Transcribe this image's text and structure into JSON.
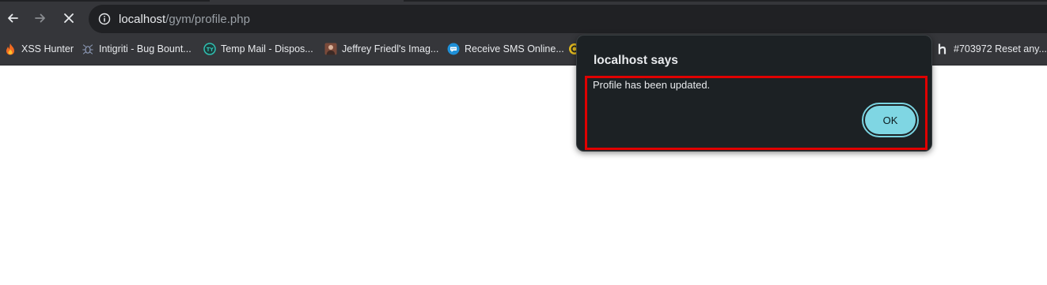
{
  "browser": {
    "url_host": "localhost",
    "url_path": "/gym/profile.php",
    "nav": {
      "back_icon": "arrow-left-icon",
      "forward_icon": "arrow-right-icon",
      "stop_icon": "close-icon",
      "site_info_icon": "info-icon"
    },
    "colors": {
      "toolbar": "#35363a",
      "omnibox": "#202124",
      "text": "#e8eaed",
      "muted_text": "#9aa0a6"
    }
  },
  "bookmarks": [
    {
      "label": "XSS Hunter",
      "icon": "flame-icon"
    },
    {
      "label": "Intigriti - Bug Bount...",
      "icon": "bug-icon"
    },
    {
      "label": "Temp Mail - Dispos...",
      "icon": "temp-mail-icon"
    },
    {
      "label": "Jeffrey Friedl's Imag...",
      "icon": "photo-icon"
    },
    {
      "label": "Receive SMS Online...",
      "icon": "chat-bubble-icon"
    },
    {
      "label": "#703972 Reset any...",
      "icon": "hackerone-icon"
    }
  ],
  "dialog": {
    "title": "localhost says",
    "message": "Profile has been updated.",
    "ok_label": "OK",
    "colors": {
      "background": "#1c2124",
      "button": "#7fd6e3",
      "highlight": "#e00000"
    }
  }
}
